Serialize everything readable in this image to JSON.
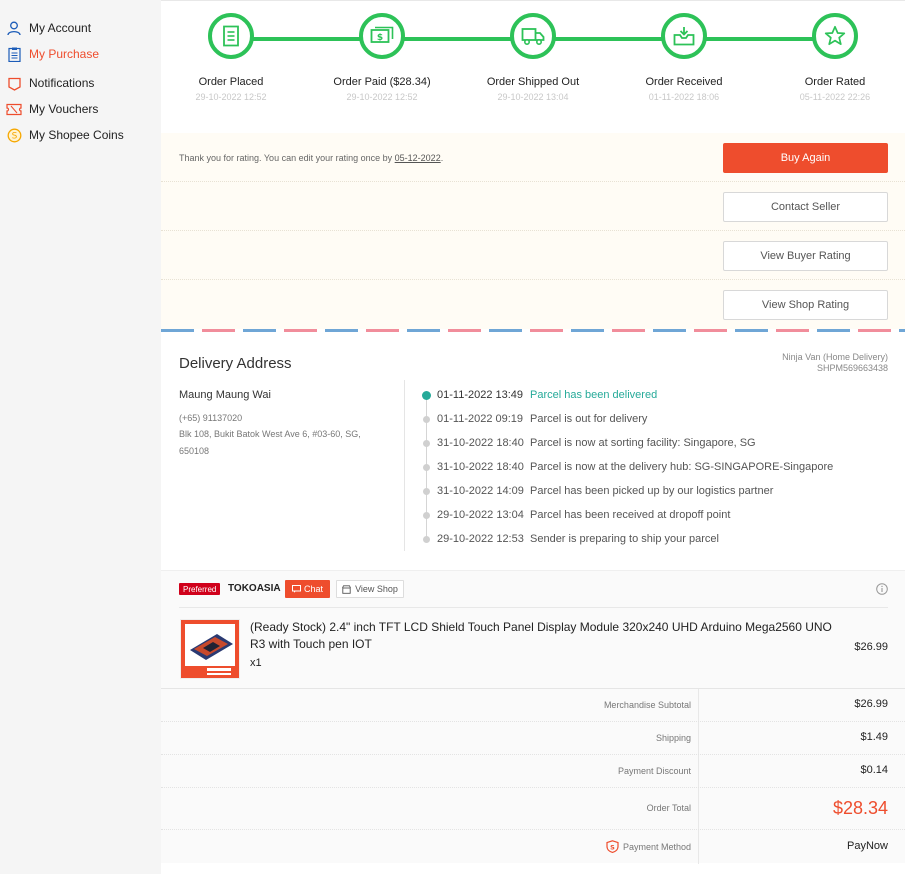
{
  "sidebar": {
    "items": [
      {
        "label": "My Account",
        "icon": "user-icon",
        "color": "#1c5cb8"
      },
      {
        "label": "My Purchase",
        "icon": "clipboard-icon",
        "color": "#1c5cb8",
        "active": true
      },
      {
        "label": "Notifications",
        "icon": "bell-icon",
        "color": "#ee4d2d"
      },
      {
        "label": "My Vouchers",
        "icon": "voucher-icon",
        "color": "#ee4d2d"
      },
      {
        "label": "My Shopee Coins",
        "icon": "coin-icon",
        "color": "#f6a700"
      }
    ]
  },
  "stepper": {
    "steps": [
      {
        "title": "Order Placed",
        "time": "29-10-2022 12:52",
        "icon": "receipt-icon"
      },
      {
        "title": "Order Paid ($28.34)",
        "time": "29-10-2022 12:52",
        "icon": "money-icon"
      },
      {
        "title": "Order Shipped Out",
        "time": "29-10-2022 13:04",
        "icon": "truck-icon"
      },
      {
        "title": "Order Received",
        "time": "01-11-2022 18:06",
        "icon": "inbox-icon"
      },
      {
        "title": "Order Rated",
        "time": "05-11-2022 22:26",
        "icon": "star-icon"
      }
    ],
    "color": "#2dc258"
  },
  "actions": {
    "rating_note": "Thank you for rating. You can edit your rating once by",
    "rating_date": "05-12-2022",
    "rating_end": ".",
    "buy_again": "Buy Again",
    "contact_seller": "Contact Seller",
    "view_buyer_rating": "View Buyer Rating",
    "view_shop_rating": "View Shop Rating"
  },
  "delivery": {
    "title": "Delivery Address",
    "courier": "Ninja Van (Home Delivery)",
    "tracking_no": "SHPM569663438",
    "name": "Maung Maung Wai",
    "phone": "(+65) 91137020",
    "address_line1": "Blk 108, Bukit Batok West Ave 6, #03-60, SG,",
    "address_line2": "650108",
    "tracking": [
      {
        "time": "01-11-2022 13:49",
        "desc": "Parcel has been delivered"
      },
      {
        "time": "01-11-2022 09:19",
        "desc": "Parcel is out for delivery"
      },
      {
        "time": "31-10-2022 18:40",
        "desc": "Parcel is now at sorting facility: Singapore, SG"
      },
      {
        "time": "31-10-2022 18:40",
        "desc": "Parcel is now at the delivery hub: SG-SINGAPORE-Singapore"
      },
      {
        "time": "31-10-2022 14:09",
        "desc": "Parcel has been picked up by our logistics partner"
      },
      {
        "time": "29-10-2022 13:04",
        "desc": "Parcel has been received at dropoff point"
      },
      {
        "time": "29-10-2022 12:53",
        "desc": "Sender is preparing to ship your parcel"
      }
    ]
  },
  "shop": {
    "badge": "Preferred",
    "name": "TOKOASIA",
    "chat_label": "Chat",
    "view_shop_label": "View Shop"
  },
  "product": {
    "name": "(Ready Stock) 2.4\" inch TFT LCD Shield Touch Panel Display Module 320x240 UHD Arduino Mega2560 UNO R3 with Touch pen IOT",
    "qty": "x1",
    "price": "$26.99"
  },
  "summary": {
    "merchandise_label": "Merchandise Subtotal",
    "merchandise_value": "$26.99",
    "shipping_label": "Shipping",
    "shipping_value": "$1.49",
    "discount_label": "Payment Discount",
    "discount_value": "$0.14",
    "total_label": "Order Total",
    "total_value": "$28.34",
    "payment_label": "Payment Method",
    "payment_value": "PayNow"
  },
  "colors": {
    "accent": "#ee4d2d",
    "success": "#2dc258",
    "teal": "#26aa99"
  }
}
